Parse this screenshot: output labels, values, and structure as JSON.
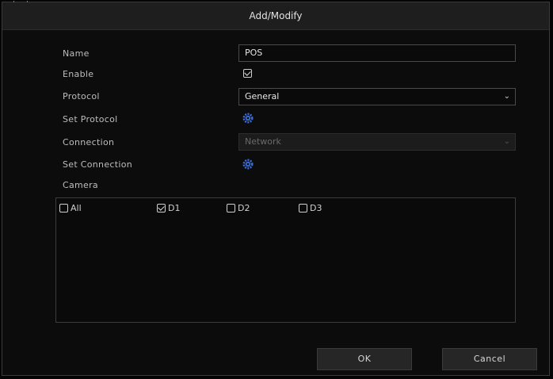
{
  "dialog": {
    "title": "Add/Modify"
  },
  "form": {
    "name_label": "Name",
    "name_value": "POS",
    "enable_label": "Enable",
    "enable_checked": true,
    "protocol_label": "Protocol",
    "protocol_value": "General",
    "set_protocol_label": "Set Protocol",
    "connection_label": "Connection",
    "connection_value": "Network",
    "set_connection_label": "Set Connection",
    "camera_label": "Camera"
  },
  "cameras": [
    {
      "label": "All",
      "checked": false
    },
    {
      "label": "D1",
      "checked": true
    },
    {
      "label": "D2",
      "checked": false
    },
    {
      "label": "D3",
      "checked": false
    }
  ],
  "buttons": {
    "ok_label": "OK",
    "cancel_label": "Cancel"
  },
  "icons": {
    "set_protocol": "gear-icon",
    "set_connection": "gear-icon",
    "dropdown": "chevron-down-icon"
  },
  "colors": {
    "gear": "#3b6fd6",
    "background": "#0c0c0c"
  }
}
